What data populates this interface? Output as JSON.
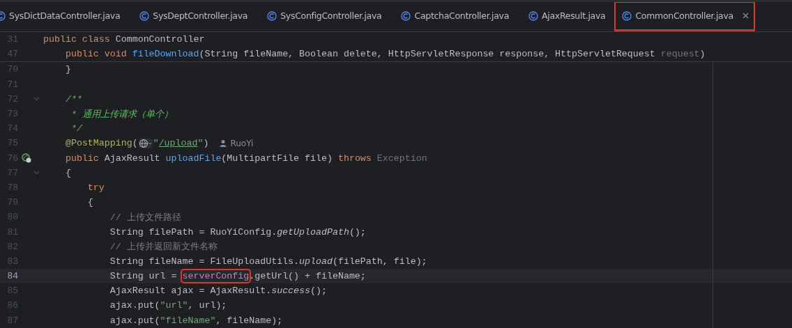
{
  "tabs": [
    {
      "label": "SysDictDataController.java",
      "selected": false,
      "marked": false
    },
    {
      "label": "SysDeptController.java",
      "selected": false,
      "marked": false
    },
    {
      "label": "SysConfigController.java",
      "selected": false,
      "marked": false
    },
    {
      "label": "CaptchaController.java",
      "selected": false,
      "marked": false
    },
    {
      "label": "AjaxResult.java",
      "selected": false,
      "marked": false
    },
    {
      "label": "CommonController.java",
      "selected": true,
      "marked": true
    }
  ],
  "sticky_lines": [
    {
      "number": "31",
      "tokens": [
        {
          "kind": "keyword",
          "text": "public class "
        },
        {
          "kind": "plain",
          "text": "CommonController"
        }
      ]
    },
    {
      "number": "47",
      "tokens": [
        {
          "kind": "keyword",
          "text": "    public void "
        },
        {
          "kind": "method",
          "text": "fileDownload"
        },
        {
          "kind": "plain",
          "text": "(String fileName, Boolean delete, HttpServletResponse response, HttpServletRequest "
        },
        {
          "kind": "unused",
          "text": "request"
        },
        {
          "kind": "plain",
          "text": ")"
        }
      ]
    }
  ],
  "lines": [
    {
      "number": "70",
      "fold": false,
      "tokens": [
        {
          "kind": "plain",
          "text": "    }"
        }
      ]
    },
    {
      "number": "71",
      "fold": false
    },
    {
      "number": "72",
      "fold": true,
      "tokens": [
        {
          "kind": "doc",
          "text": "    /**"
        }
      ]
    },
    {
      "number": "73",
      "fold": false,
      "tokens": [
        {
          "kind": "doc",
          "text": "     * 通用上传请求（单个）"
        }
      ]
    },
    {
      "number": "74",
      "fold": false,
      "tokens": [
        {
          "kind": "doc",
          "text": "     */"
        }
      ]
    },
    {
      "number": "75",
      "fold": false,
      "tokens": [
        {
          "kind": "annotation",
          "text": "    @PostMapping"
        },
        {
          "kind": "plain",
          "text": "("
        },
        {
          "kind": "url-inlay"
        },
        {
          "kind": "string",
          "text": "\""
        },
        {
          "kind": "link",
          "text": "/upload"
        },
        {
          "kind": "string",
          "text": "\""
        },
        {
          "kind": "plain",
          "text": ")"
        },
        {
          "kind": "author-hint",
          "text": "RuoYi"
        }
      ]
    },
    {
      "number": "76",
      "fold": false,
      "gutter_icon": {
        "kind": "endpoint"
      },
      "tokens": [
        {
          "kind": "keyword",
          "text": "    public "
        },
        {
          "kind": "plain",
          "text": "AjaxResult "
        },
        {
          "kind": "method",
          "text": "uploadFile"
        },
        {
          "kind": "plain",
          "text": "(MultipartFile file) "
        },
        {
          "kind": "keyword",
          "text": "throws "
        },
        {
          "kind": "unused",
          "text": "Exception"
        }
      ]
    },
    {
      "number": "77",
      "fold": true,
      "tokens": [
        {
          "kind": "plain",
          "text": "    {"
        }
      ]
    },
    {
      "number": "78",
      "fold": false,
      "tokens": [
        {
          "kind": "keyword",
          "text": "        try"
        }
      ]
    },
    {
      "number": "79",
      "fold": false,
      "tokens": [
        {
          "kind": "plain",
          "text": "        {"
        }
      ]
    },
    {
      "number": "80",
      "fold": false,
      "tokens": [
        {
          "kind": "comment",
          "text": "            // 上传文件路径"
        }
      ]
    },
    {
      "number": "81",
      "fold": false,
      "tokens": [
        {
          "kind": "plain",
          "text": "            String filePath = RuoYiConfig."
        },
        {
          "kind": "static",
          "text": "getUploadPath"
        },
        {
          "kind": "plain",
          "text": "();"
        }
      ]
    },
    {
      "number": "82",
      "fold": false,
      "tokens": [
        {
          "kind": "comment",
          "text": "            // 上传并返回新文件名称"
        }
      ]
    },
    {
      "number": "83",
      "fold": false,
      "tokens": [
        {
          "kind": "plain",
          "text": "            String fileName = FileUploadUtils."
        },
        {
          "kind": "static",
          "text": "upload"
        },
        {
          "kind": "plain",
          "text": "(filePath, file);"
        }
      ]
    },
    {
      "number": "84",
      "fold": false,
      "current": true,
      "tokens": [
        {
          "kind": "plain",
          "text": "            String url = "
        },
        {
          "kind": "field",
          "text": "serverConfig",
          "boxed": true
        },
        {
          "kind": "plain",
          "text": ".getUrl() + fileName;"
        }
      ]
    },
    {
      "number": "85",
      "fold": false,
      "tokens": [
        {
          "kind": "plain",
          "text": "            AjaxResult ajax = AjaxResult."
        },
        {
          "kind": "static",
          "text": "success"
        },
        {
          "kind": "plain",
          "text": "();"
        }
      ]
    },
    {
      "number": "86",
      "fold": false,
      "tokens": [
        {
          "kind": "plain",
          "text": "            ajax.put("
        },
        {
          "kind": "string",
          "text": "\"url\""
        },
        {
          "kind": "plain",
          "text": ", url);"
        }
      ]
    },
    {
      "number": "87",
      "fold": false,
      "tokens": [
        {
          "kind": "plain",
          "text": "            ajax.put("
        },
        {
          "kind": "string",
          "text": "\"fileName\""
        },
        {
          "kind": "plain",
          "text": ", fileName);"
        }
      ]
    }
  ]
}
